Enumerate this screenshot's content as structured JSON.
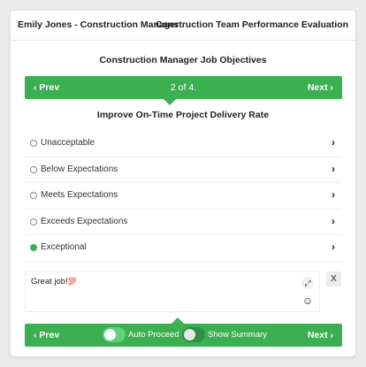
{
  "header": {
    "left_title": "Emily Jones - Construction Manager",
    "right_title": "Construction Team Performance Evaluation"
  },
  "section": {
    "title": "Construction Manager Job Objectives"
  },
  "nav_top": {
    "prev_label": "Prev",
    "page_indicator": "2 of 4.",
    "next_label": "Next"
  },
  "question": {
    "title": "Improve On-Time Project Delivery Rate",
    "options": [
      {
        "label": "Unacceptable",
        "selected": false
      },
      {
        "label": "Below Expectations",
        "selected": false
      },
      {
        "label": "Meets Expectations",
        "selected": false
      },
      {
        "label": "Exceeds Expectations",
        "selected": false
      },
      {
        "label": "Exceptional",
        "selected": true
      }
    ]
  },
  "comment": {
    "text": "Great job!",
    "emoji": "💯",
    "close_label": "X"
  },
  "nav_bottom": {
    "prev_label": "Prev",
    "next_label": "Next",
    "auto_proceed_label": "Auto Proceed",
    "auto_proceed_on": true,
    "show_summary_label": "Show Summary",
    "show_summary_on": false
  },
  "colors": {
    "accent": "#3daf53",
    "background": "#ebebeb"
  }
}
